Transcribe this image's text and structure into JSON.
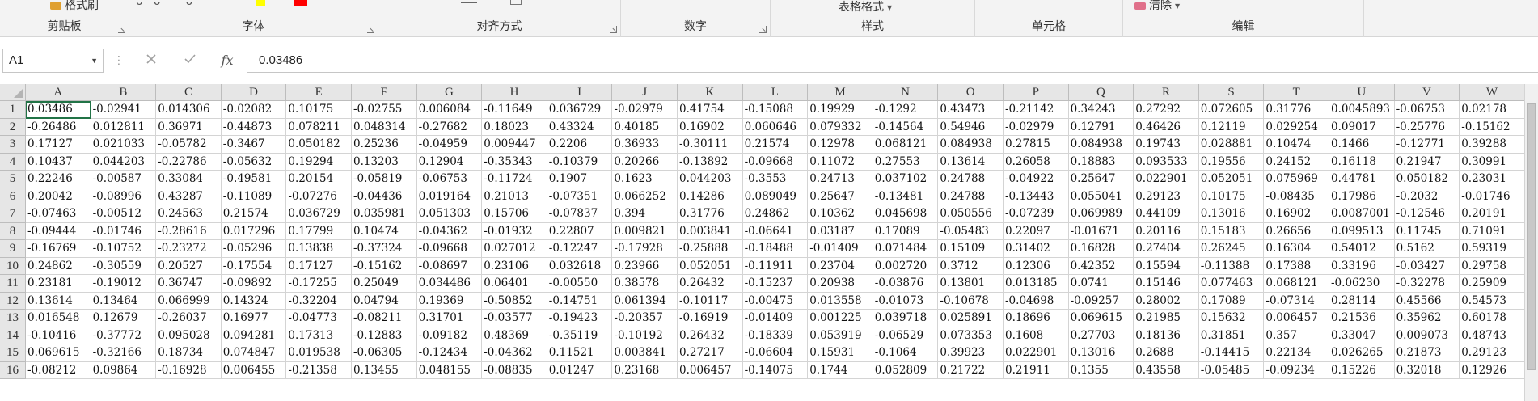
{
  "ribbon": {
    "groups": [
      {
        "label": "剪贴板",
        "launcher": true
      },
      {
        "label": "字体",
        "launcher": true
      },
      {
        "label": "对齐方式",
        "launcher": true
      },
      {
        "label": "数字",
        "launcher": true
      },
      {
        "label": "样式",
        "launcher": false
      },
      {
        "label": "单元格",
        "launcher": false
      },
      {
        "label": "编辑",
        "launcher": false
      }
    ],
    "format_painter": "格式刷",
    "table_format": "表格格式",
    "clear": "清除",
    "colors": {
      "highlight": "#ffff00",
      "font": "#ff0000"
    }
  },
  "formula_bar": {
    "name_box": "A1",
    "formula": "0.03486",
    "fx": "fx"
  },
  "grid": {
    "columns": [
      "A",
      "B",
      "C",
      "D",
      "E",
      "F",
      "G",
      "H",
      "I",
      "J",
      "K",
      "L",
      "M",
      "N",
      "O",
      "P",
      "Q",
      "R",
      "S",
      "T",
      "U",
      "V",
      "W"
    ],
    "rows": [
      {
        "num": "1",
        "cells": [
          "0.03486",
          "-0.02941",
          "0.014306",
          "-0.02082",
          "0.10175",
          "-0.02755",
          "0.006084",
          "-0.11649",
          "0.036729",
          "-0.02979",
          "0.41754",
          "-0.15088",
          "0.19929",
          "-0.1292",
          "0.43473",
          "-0.21142",
          "0.34243",
          "0.27292",
          "0.072605",
          "0.31776",
          "0.0045893",
          "-0.06753",
          "0.02178"
        ]
      },
      {
        "num": "2",
        "cells": [
          "-0.26486",
          "0.012811",
          "0.36971",
          "-0.44873",
          "0.078211",
          "0.048314",
          "-0.27682",
          "0.18023",
          "0.43324",
          "0.40185",
          "0.16902",
          "0.060646",
          "0.079332",
          "-0.14564",
          "0.54946",
          "-0.02979",
          "0.12791",
          "0.46426",
          "0.12119",
          "0.029254",
          "0.09017",
          "-0.25776",
          "-0.15162"
        ]
      },
      {
        "num": "3",
        "cells": [
          "0.17127",
          "0.021033",
          "-0.05782",
          "-0.3467",
          "0.050182",
          "0.25236",
          "-0.04959",
          "0.009447",
          "0.2206",
          "0.36933",
          "-0.30111",
          "0.21574",
          "0.12978",
          "0.068121",
          "0.084938",
          "0.27815",
          "0.084938",
          "0.19743",
          "0.028881",
          "0.10474",
          "0.1466",
          "-0.12771",
          "0.39288"
        ]
      },
      {
        "num": "4",
        "cells": [
          "0.10437",
          "0.044203",
          "-0.22786",
          "-0.05632",
          "0.19294",
          "0.13203",
          "0.12904",
          "-0.35343",
          "-0.10379",
          "0.20266",
          "-0.13892",
          "-0.09668",
          "0.11072",
          "0.27553",
          "0.13614",
          "0.26058",
          "0.18883",
          "0.093533",
          "0.19556",
          "0.24152",
          "0.16118",
          "0.21947",
          "0.30991"
        ]
      },
      {
        "num": "5",
        "cells": [
          "0.22246",
          "-0.00587",
          "0.33084",
          "-0.49581",
          "0.20154",
          "-0.05819",
          "-0.06753",
          "-0.11724",
          "0.1907",
          "0.1623",
          "0.044203",
          "-0.3553",
          "0.24713",
          "0.037102",
          "0.24788",
          "-0.04922",
          "0.25647",
          "0.022901",
          "0.052051",
          "0.075969",
          "0.44781",
          "0.050182",
          "0.23031"
        ]
      },
      {
        "num": "6",
        "cells": [
          "0.20042",
          "-0.08996",
          "0.43287",
          "-0.11089",
          "-0.07276",
          "-0.04436",
          "0.019164",
          "0.21013",
          "-0.07351",
          "0.066252",
          "0.14286",
          "0.089049",
          "0.25647",
          "-0.13481",
          "0.24788",
          "-0.13443",
          "0.055041",
          "0.29123",
          "0.10175",
          "-0.08435",
          "0.17986",
          "-0.2032",
          "-0.01746"
        ]
      },
      {
        "num": "7",
        "cells": [
          "-0.07463",
          "-0.00512",
          "0.24563",
          "0.21574",
          "0.036729",
          "0.035981",
          "0.051303",
          "0.15706",
          "-0.07837",
          "0.394",
          "0.31776",
          "0.24862",
          "0.10362",
          "0.045698",
          "0.050556",
          "-0.07239",
          "0.069989",
          "0.44109",
          "0.13016",
          "0.16902",
          "0.0087001",
          "-0.12546",
          "0.20191"
        ]
      },
      {
        "num": "8",
        "cells": [
          "-0.09444",
          "-0.01746",
          "-0.28616",
          "0.017296",
          "0.17799",
          "0.10474",
          "-0.04362",
          "-0.01932",
          "0.22807",
          "0.009821",
          "0.003841",
          "-0.06641",
          "0.03187",
          "0.17089",
          "-0.05483",
          "0.22097",
          "-0.01671",
          "0.20116",
          "0.15183",
          "0.26656",
          "0.099513",
          "0.11745",
          "0.71091"
        ]
      },
      {
        "num": "9",
        "cells": [
          "-0.16769",
          "-0.10752",
          "-0.23272",
          "-0.05296",
          "0.13838",
          "-0.37324",
          "-0.09668",
          "0.027012",
          "-0.12247",
          "-0.17928",
          "-0.25888",
          "-0.18488",
          "-0.01409",
          "0.071484",
          "0.15109",
          "0.31402",
          "0.16828",
          "0.27404",
          "0.26245",
          "0.16304",
          "0.54012",
          "0.5162",
          "0.59319"
        ]
      },
      {
        "num": "10",
        "cells": [
          "0.24862",
          "-0.30559",
          "0.20527",
          "-0.17554",
          "0.17127",
          "-0.15162",
          "-0.08697",
          "0.23106",
          "0.032618",
          "0.23966",
          "0.052051",
          "-0.11911",
          "0.23704",
          "0.002720",
          "0.3712",
          "0.12306",
          "0.42352",
          "0.15594",
          "-0.11388",
          "0.17388",
          "0.33196",
          "-0.03427",
          "0.29758"
        ]
      },
      {
        "num": "11",
        "cells": [
          "0.23181",
          "-0.19012",
          "0.36747",
          "-0.09892",
          "-0.17255",
          "0.25049",
          "0.034486",
          "0.06401",
          "-0.00550",
          "0.38578",
          "0.26432",
          "-0.15237",
          "0.20938",
          "-0.03876",
          "0.13801",
          "0.013185",
          "0.0741",
          "0.15146",
          "0.077463",
          "0.068121",
          "-0.06230",
          "-0.32278",
          "0.25909"
        ]
      },
      {
        "num": "12",
        "cells": [
          "0.13614",
          "0.13464",
          "0.066999",
          "0.14324",
          "-0.32204",
          "0.04794",
          "0.19369",
          "-0.50852",
          "-0.14751",
          "0.061394",
          "-0.10117",
          "-0.00475",
          "0.013558",
          "-0.01073",
          "-0.10678",
          "-0.04698",
          "-0.09257",
          "0.28002",
          "0.17089",
          "-0.07314",
          "0.28114",
          "0.45566",
          "0.54573"
        ]
      },
      {
        "num": "13",
        "cells": [
          "0.016548",
          "0.12679",
          "-0.26037",
          "0.16977",
          "-0.04773",
          "-0.08211",
          "0.31701",
          "-0.03577",
          "-0.19423",
          "-0.20357",
          "-0.16919",
          "-0.01409",
          "0.001225",
          "0.039718",
          "0.025891",
          "0.18696",
          "0.069615",
          "0.21985",
          "0.15632",
          "0.006457",
          "0.21536",
          "0.35962",
          "0.60178"
        ]
      },
      {
        "num": "14",
        "cells": [
          "-0.10416",
          "-0.37772",
          "0.095028",
          "0.094281",
          "0.17313",
          "-0.12883",
          "-0.09182",
          "0.48369",
          "-0.35119",
          "-0.10192",
          "0.26432",
          "-0.18339",
          "0.053919",
          "-0.06529",
          "0.073353",
          "0.1608",
          "0.27703",
          "0.18136",
          "0.31851",
          "0.357",
          "0.33047",
          "0.009073",
          "0.48743"
        ]
      },
      {
        "num": "15",
        "cells": [
          "0.069615",
          "-0.32166",
          "0.18734",
          "0.074847",
          "0.019538",
          "-0.06305",
          "-0.12434",
          "-0.04362",
          "0.11521",
          "0.003841",
          "0.27217",
          "-0.06604",
          "0.15931",
          "-0.1064",
          "0.39923",
          "0.022901",
          "0.13016",
          "0.2688",
          "-0.14415",
          "0.22134",
          "0.026265",
          "0.21873",
          "0.29123"
        ]
      },
      {
        "num": "16",
        "cells": [
          "-0.08212",
          "0.09864",
          "-0.16928",
          "0.006455",
          "-0.21358",
          "0.13455",
          "0.048155",
          "-0.08835",
          "0.01247",
          "0.23168",
          "0.006457",
          "-0.14075",
          "0.1744",
          "0.052809",
          "0.21722",
          "0.21911",
          "0.1355",
          "0.43558",
          "-0.05485",
          "-0.09234",
          "0.15226",
          "0.32018",
          "0.12926"
        ]
      }
    ]
  }
}
